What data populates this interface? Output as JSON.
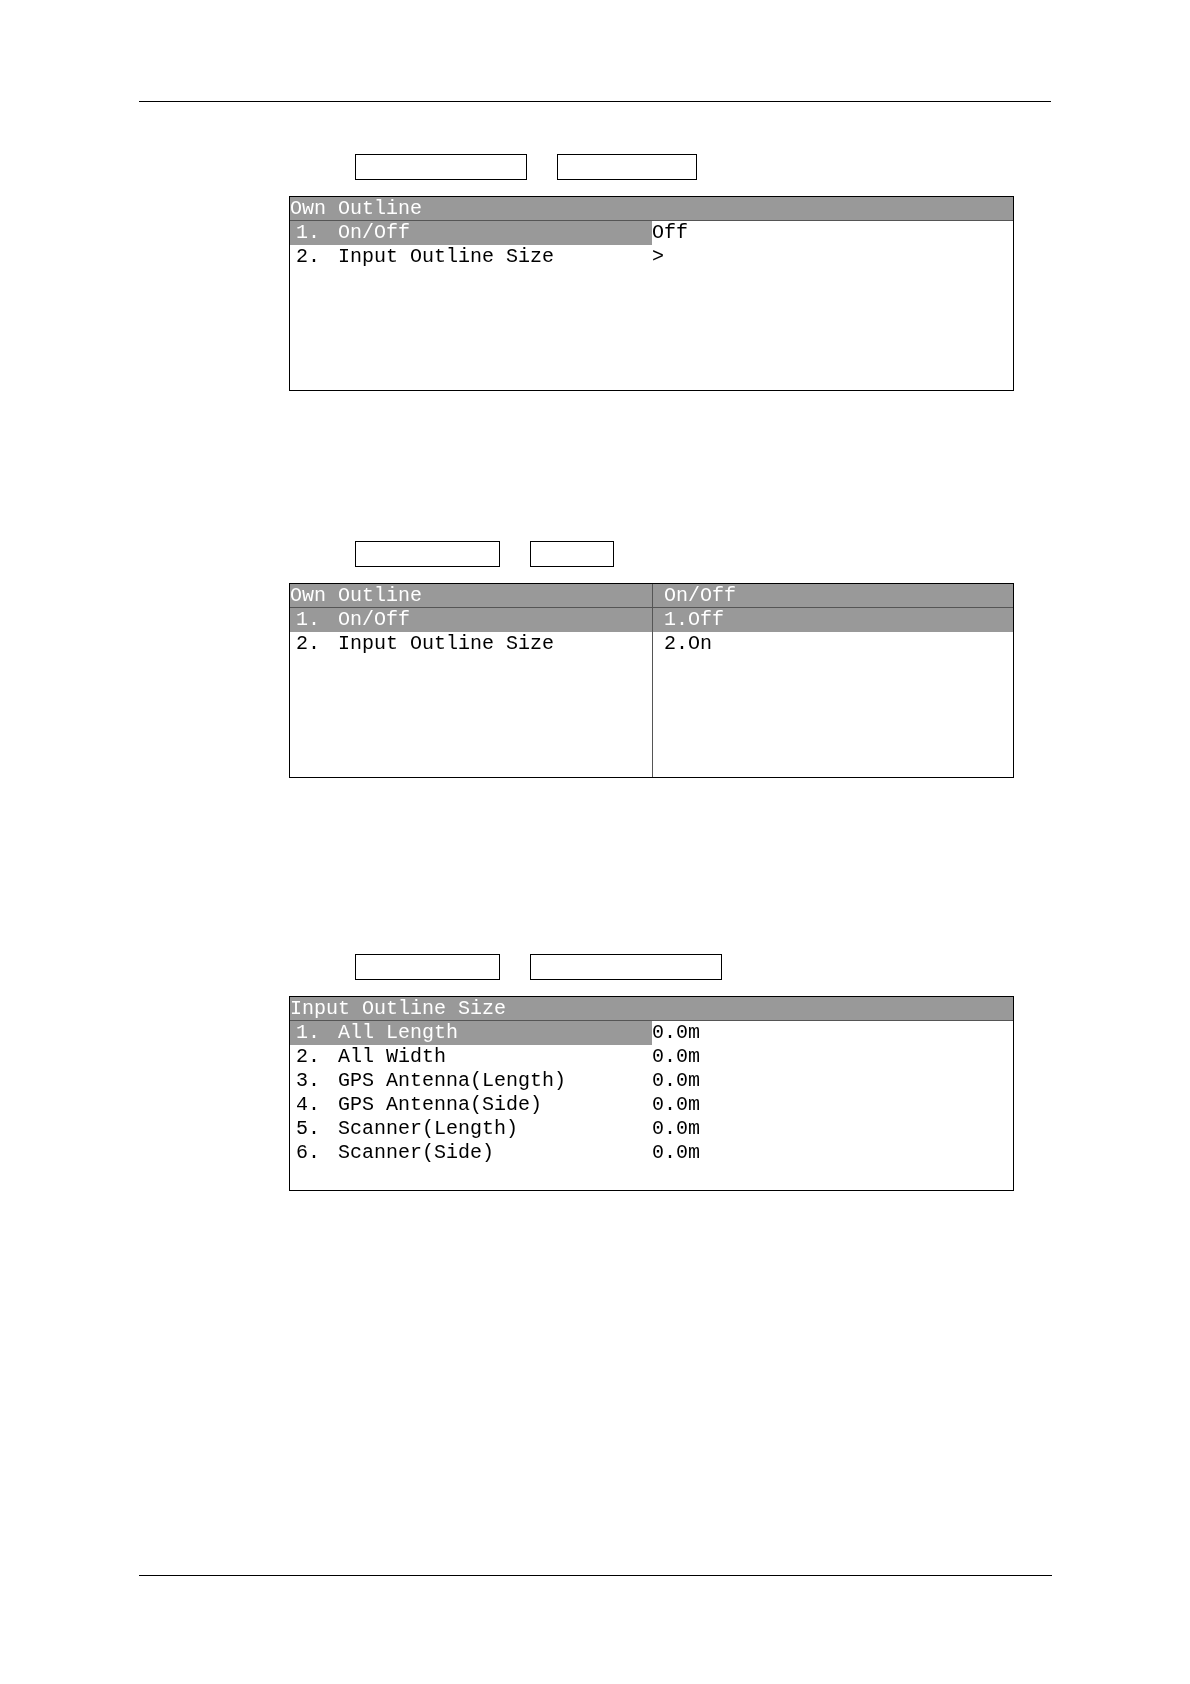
{
  "panels": [
    {
      "kind": "list",
      "title": "Own Outline",
      "items": [
        {
          "number": "1.",
          "label": "On/Off",
          "value": "Off",
          "selected": true
        },
        {
          "number": "2.",
          "label": "Input Outline Size",
          "value": ">",
          "selected": false
        }
      ]
    },
    {
      "kind": "split",
      "title": "Own Outline",
      "items": [
        {
          "number": "1.",
          "label": "On/Off",
          "selected": true
        },
        {
          "number": "2.",
          "label": "Input Outline Size",
          "selected": false
        }
      ],
      "submenu": {
        "title": "On/Off",
        "options": [
          {
            "label": "1.Off",
            "selected": true
          },
          {
            "label": "2.On",
            "selected": false
          }
        ]
      }
    },
    {
      "kind": "list",
      "title": "Input Outline Size",
      "items": [
        {
          "number": "1.",
          "label": "All Length",
          "value": "0.0m",
          "selected": true
        },
        {
          "number": "2.",
          "label": "All Width",
          "value": "0.0m",
          "selected": false
        },
        {
          "number": "3.",
          "label": "GPS Antenna(Length)",
          "value": "0.0m",
          "selected": false
        },
        {
          "number": "4.",
          "label": "GPS Antenna(Side)",
          "value": "0.0m",
          "selected": false
        },
        {
          "number": "5.",
          "label": "Scanner(Length)",
          "value": "0.0m",
          "selected": false
        },
        {
          "number": "6.",
          "label": "Scanner(Side)",
          "value": "0.0m",
          "selected": false
        }
      ]
    }
  ]
}
